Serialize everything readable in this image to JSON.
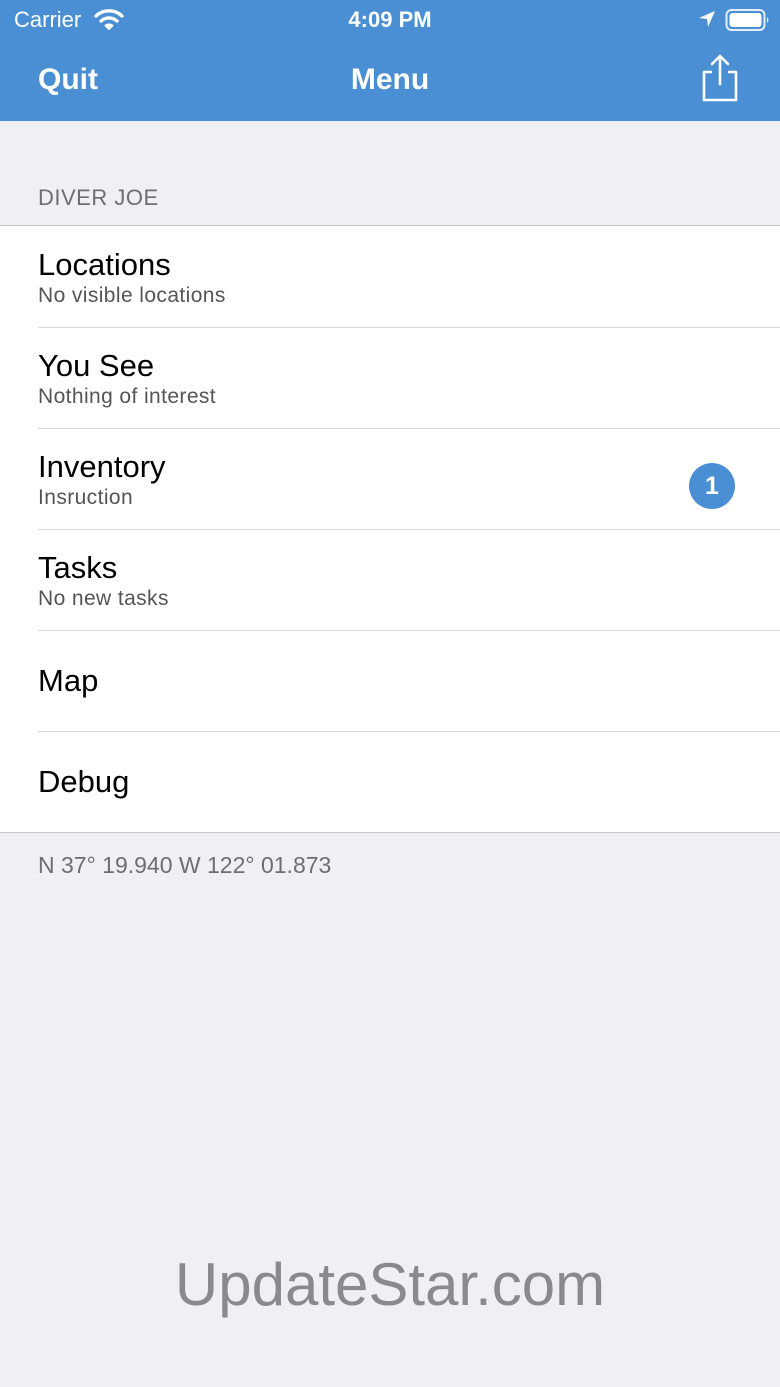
{
  "status_bar": {
    "carrier": "Carrier",
    "time": "4:09 PM",
    "icons": [
      "wifi-icon",
      "location-arrow-icon",
      "battery-icon"
    ]
  },
  "nav": {
    "left_label": "Quit",
    "title": "Menu",
    "right_icon": "share-icon"
  },
  "section": {
    "header": "DIVER JOE"
  },
  "menu": {
    "items": [
      {
        "title": "Locations",
        "subtitle": "No visible locations"
      },
      {
        "title": "You See",
        "subtitle": "Nothing of interest"
      },
      {
        "title": "Inventory",
        "subtitle": "Insruction",
        "badge": "1"
      },
      {
        "title": "Tasks",
        "subtitle": "No new tasks"
      },
      {
        "title": "Map"
      },
      {
        "title": "Debug"
      }
    ]
  },
  "footer": {
    "coordinates": "N 37° 19.940 W 122° 01.873"
  },
  "watermark": "UpdateStar.com",
  "colors": {
    "accent": "#4a8fd3",
    "background": "#efeff4",
    "cell": "#ffffff",
    "secondary_text": "#6d6d72"
  }
}
